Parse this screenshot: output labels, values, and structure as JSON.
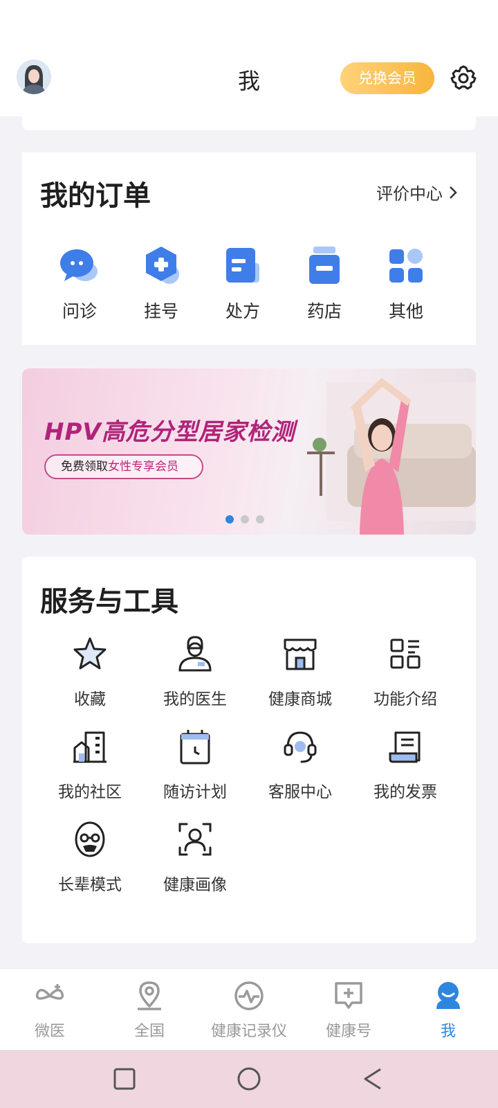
{
  "header": {
    "title": "我",
    "vip_button": "兑换会员"
  },
  "orders": {
    "title": "我的订单",
    "review_link": "评价中心",
    "items": [
      {
        "label": "问诊",
        "icon": "chat-bubble-icon"
      },
      {
        "label": "挂号",
        "icon": "hexagon-plus-icon"
      },
      {
        "label": "处方",
        "icon": "prescription-icon"
      },
      {
        "label": "药店",
        "icon": "pill-bottle-icon"
      },
      {
        "label": "其他",
        "icon": "grid-icon"
      }
    ]
  },
  "banner": {
    "title": "HPV高危分型居家检测",
    "pill_prefix": "免费领取",
    "pill_highlight": "女性专享会员",
    "page_count": 3,
    "active_index": 0
  },
  "services": {
    "title": "服务与工具",
    "items": [
      {
        "label": "收藏",
        "icon": "star-icon"
      },
      {
        "label": "我的医生",
        "icon": "doctor-icon"
      },
      {
        "label": "健康商城",
        "icon": "store-icon"
      },
      {
        "label": "功能介绍",
        "icon": "layout-icon"
      },
      {
        "label": "我的社区",
        "icon": "building-icon"
      },
      {
        "label": "随访计划",
        "icon": "calendar-clock-icon"
      },
      {
        "label": "客服中心",
        "icon": "headset-icon"
      },
      {
        "label": "我的发票",
        "icon": "invoice-icon"
      },
      {
        "label": "长辈模式",
        "icon": "elder-icon"
      },
      {
        "label": "健康画像",
        "icon": "face-scan-icon"
      }
    ]
  },
  "tabbar": {
    "items": [
      {
        "label": "微医",
        "icon": "weiyi-logo-icon",
        "active": false
      },
      {
        "label": "全国",
        "icon": "location-pin-icon",
        "active": false
      },
      {
        "label": "健康记录仪",
        "icon": "pulse-icon",
        "active": false
      },
      {
        "label": "健康号",
        "icon": "message-plus-icon",
        "active": false
      },
      {
        "label": "我",
        "icon": "profile-icon",
        "active": true
      }
    ]
  },
  "colors": {
    "accent_blue": "#2e86de",
    "vip_gold": "#f7b63d",
    "banner_magenta": "#b0237a"
  }
}
